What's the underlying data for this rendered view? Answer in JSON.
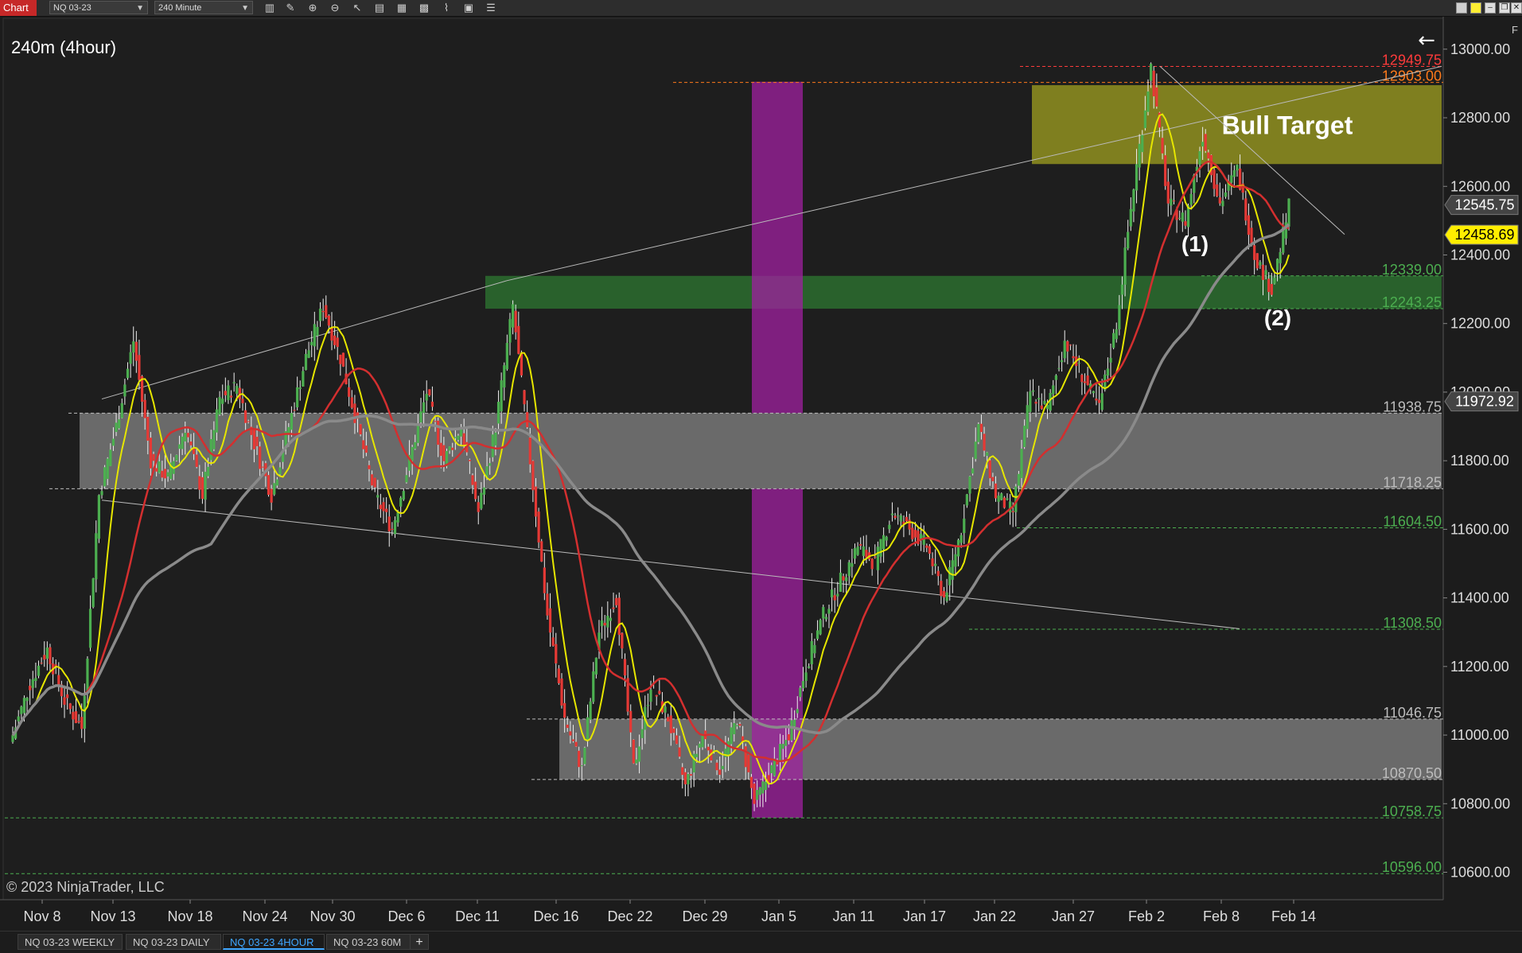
{
  "toolbar": {
    "chart_label": "Chart",
    "instrument": "NQ 03-23",
    "interval": "240 Minute"
  },
  "chart_data": {
    "type": "candlestick",
    "title": "240m (4hour)",
    "copyright": "© 2023 NinjaTrader, LLC",
    "ylim": [
      10520,
      13090
    ],
    "y_ticks": [
      10600,
      10800,
      11000,
      11200,
      11400,
      11600,
      11800,
      12000,
      12200,
      12400,
      12600,
      12800,
      13000
    ],
    "y_tick_labels": [
      "10600.00",
      "10800.00",
      "11000.00",
      "11200.00",
      "11400.00",
      "11600.00",
      "11800.00",
      "12000.00",
      "12200.00",
      "12400.00",
      "12600.00",
      "12800.00",
      "13000.00"
    ],
    "x_tick_labels": [
      "Nov 8",
      "Nov 13",
      "Nov 18",
      "Nov 24",
      "Nov 30",
      "Dec 6",
      "Dec 11",
      "Dec 16",
      "Dec 22",
      "Dec 29",
      "Jan 5",
      "Jan 11",
      "Jan 17",
      "Jan 22",
      "Jan 27",
      "Feb 2",
      "Feb 8",
      "Feb 14"
    ],
    "price_path": [
      11000,
      11150,
      11250,
      11100,
      11020,
      11700,
      11900,
      12150,
      11800,
      11750,
      11900,
      11700,
      11980,
      12020,
      11850,
      11700,
      11900,
      12100,
      12250,
      12100,
      11900,
      11700,
      11600,
      11800,
      12000,
      11800,
      11900,
      11650,
      11900,
      12250,
      11800,
      11350,
      11050,
      10900,
      11300,
      11400,
      10900,
      11150,
      11050,
      10850,
      11000,
      10900,
      11050,
      10800,
      10900,
      11000,
      11200,
      11350,
      11450,
      11550,
      11500,
      11650,
      11600,
      11550,
      11400,
      11600,
      11900,
      11700,
      11650,
      12000,
      11950,
      12150,
      12050,
      11950,
      12200,
      12600,
      12950,
      12550,
      12500,
      12750,
      12550,
      12650,
      12400,
      12300,
      12540
    ],
    "current_price": 12545.75,
    "current_price_label": "12545.75",
    "sma_fast_last_label": "12458.69",
    "sma_slow_last_label": "11972.92",
    "zones": [
      {
        "name": "Bull Target",
        "label": "Bull Target",
        "top": 12895,
        "bottom": 12665,
        "color": "#a8a820"
      },
      {
        "name": "demand-green",
        "top": 12339.0,
        "bottom": 12243.25,
        "color": "#2e7d32"
      },
      {
        "name": "range-grey-upper",
        "top": 11938.75,
        "bottom": 11718.25,
        "color": "#8a8a8a"
      },
      {
        "name": "range-grey-lower",
        "top": 11046.75,
        "bottom": 10870.5,
        "color": "#8a8a8a"
      }
    ],
    "levels": [
      {
        "value": 12949.75,
        "label": "12949.75",
        "color": "#ff3b3b"
      },
      {
        "value": 12903.0,
        "label": "12903.00",
        "color": "#ff7a1a"
      },
      {
        "value": 12339.0,
        "label": "12339.00",
        "color": "#4caf50"
      },
      {
        "value": 12243.25,
        "label": "12243.25",
        "color": "#4caf50"
      },
      {
        "value": 11938.75,
        "label": "11938.75",
        "color": "#bdbdbd"
      },
      {
        "value": 11718.25,
        "label": "11718.25",
        "color": "#bdbdbd"
      },
      {
        "value": 11604.5,
        "label": "11604.50",
        "color": "#4caf50"
      },
      {
        "value": 11308.5,
        "label": "11308.50",
        "color": "#4caf50"
      },
      {
        "value": 11046.75,
        "label": "11046.75",
        "color": "#bdbdbd"
      },
      {
        "value": 10870.5,
        "label": "10870.50",
        "color": "#bdbdbd"
      },
      {
        "value": 10758.75,
        "label": "10758.75",
        "color": "#4caf50"
      },
      {
        "value": 10596.0,
        "label": "10596.00",
        "color": "#4caf50"
      }
    ],
    "annotations": [
      {
        "name": "wave-1",
        "text": "(1)",
        "price": 12410
      },
      {
        "name": "wave-2",
        "text": "(2)",
        "price": 12195
      }
    ],
    "colors": {
      "up": "#4caf50",
      "down": "#e53935",
      "sma_fast": "#e6e600",
      "sma_mid": "#d32f2f",
      "sma_slow": "#8a8a8a",
      "vertical_band": "#a020a0"
    }
  },
  "tabs": [
    {
      "label": "NQ 03-23 WEEKLY"
    },
    {
      "label": "NQ 03-23 DAILY"
    },
    {
      "label": "NQ 03-23 4HOUR",
      "active": true
    },
    {
      "label": "NQ 03-23 60M"
    }
  ],
  "tab_add_label": "+",
  "panel_side_label": "F"
}
